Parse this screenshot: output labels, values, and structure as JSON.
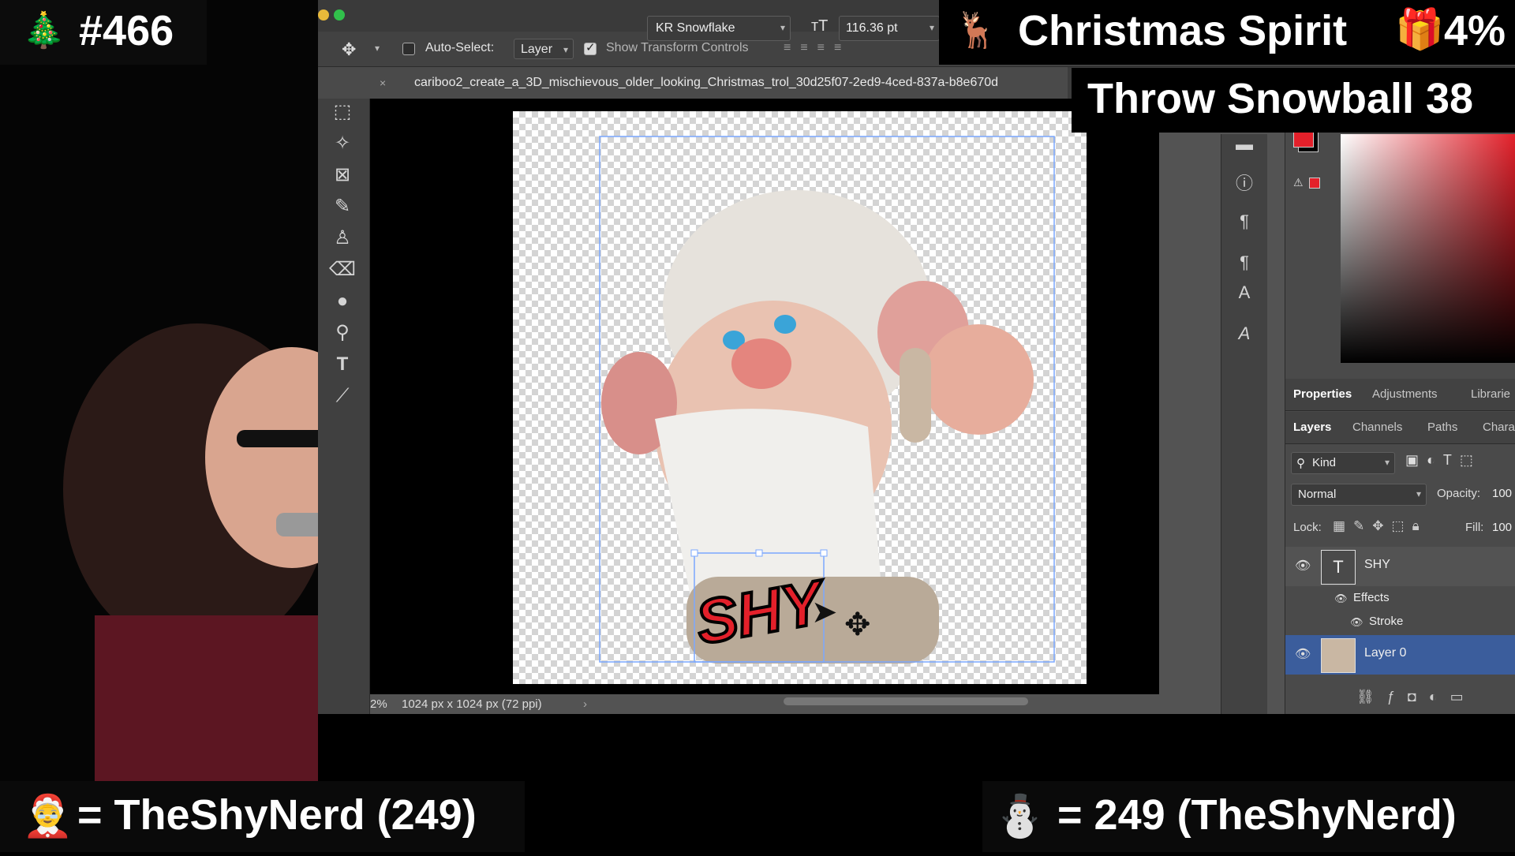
{
  "overlay": {
    "counter": "#466",
    "goal_name": "Christmas Spirit",
    "goal_percent": "4%",
    "snowball_label": "Throw Snowball 38",
    "leader_left": "= TheShyNerd (249)",
    "leader_right": "= 249 (TheShyNerd)"
  },
  "options_bar": {
    "auto_select_label": "Auto-Select:",
    "auto_select_value": "Layer",
    "show_transform_label": "Show Transform Controls",
    "font_family": "KR Snowflake",
    "font_size": "116.36 pt"
  },
  "document": {
    "tab_title": "cariboo2_create_a_3D_mischievous_older_looking_Christmas_trol_30d25f07-2ed9-4ced-837a-b8e670d",
    "artwork_text": "SHY",
    "zoom": "2%",
    "dimensions": "1024 px x 1024 px (72 ppi)"
  },
  "panels": {
    "top_tabs": [
      "Properties",
      "Adjustments",
      "Librarie"
    ],
    "layer_tabs": [
      "Layers",
      "Channels",
      "Paths",
      "Chara"
    ],
    "filter_kind": "Kind",
    "blend_mode": "Normal",
    "opacity_label": "Opacity:",
    "opacity_value": "100",
    "lock_label": "Lock:",
    "fill_label": "Fill:",
    "fill_value": "100",
    "layers": [
      {
        "name": "SHY",
        "type": "text"
      },
      {
        "name": "Effects",
        "type": "effects"
      },
      {
        "name": "Stroke",
        "type": "effect"
      },
      {
        "name": "Layer 0",
        "type": "image",
        "selected": true
      }
    ]
  },
  "colors": {
    "foreground": "#e3202a",
    "background": "#000000",
    "selected_layer": "#3b5d9c",
    "selection_box": "#7aa7ff"
  },
  "icons": {
    "counter_icon": "christmas-tree-icon",
    "goal_icon": "reindeer-icon",
    "gift_icon": "gift-icon",
    "leader_left_icon": "santa-icon",
    "leader_right_icon": "snowman-icon"
  }
}
